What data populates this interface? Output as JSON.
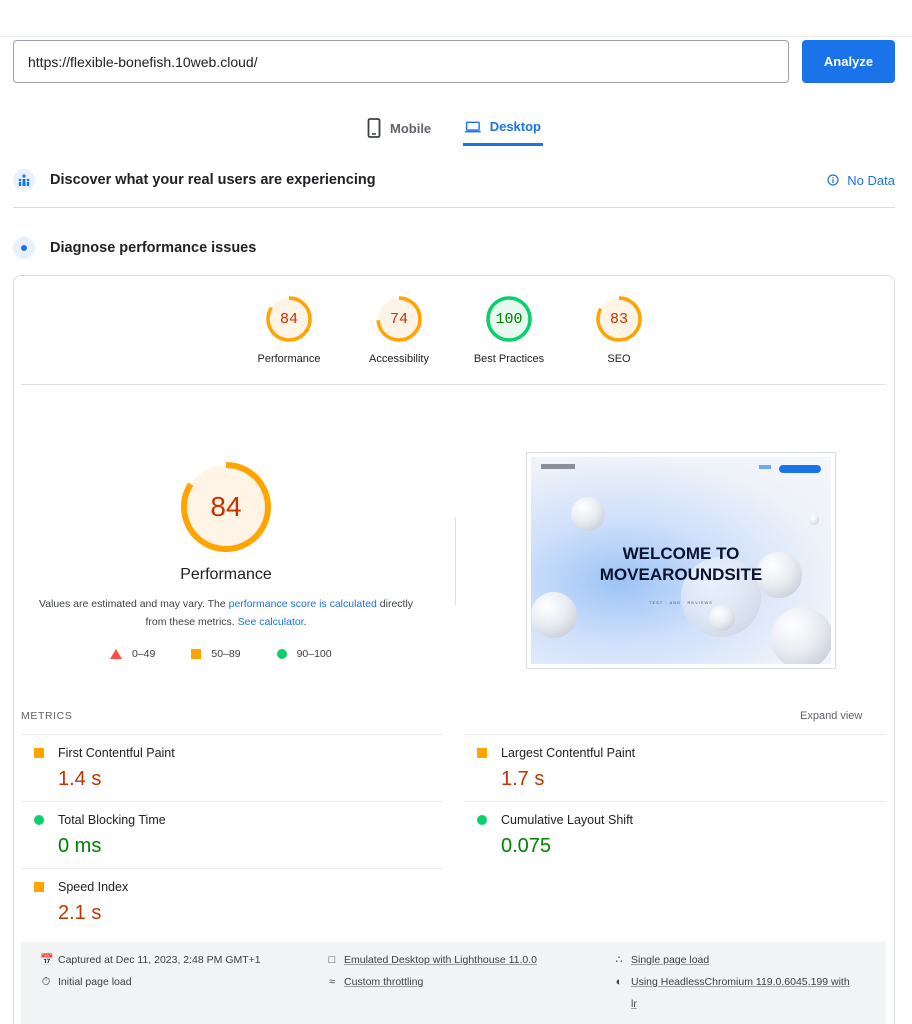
{
  "url_bar": {
    "value": "https://flexible-bonefish.10web.cloud/",
    "analyze_label": "Analyze"
  },
  "device_tabs": {
    "mobile": "Mobile",
    "desktop": "Desktop",
    "selected": "desktop"
  },
  "field_data": {
    "title": "Discover what your real users are experiencing",
    "status": "No Data"
  },
  "lab_data": {
    "title": "Diagnose performance issues"
  },
  "category_scores": [
    {
      "label": "Performance",
      "score": "84",
      "status": "average"
    },
    {
      "label": "Accessibility",
      "score": "74",
      "status": "average"
    },
    {
      "label": "Best Practices",
      "score": "100",
      "status": "pass"
    },
    {
      "label": "SEO",
      "score": "83",
      "status": "average"
    }
  ],
  "performance": {
    "score": "84",
    "title": "Performance",
    "desc_prefix": "Values are estimated and may vary. The ",
    "desc_link": "performance score is calculated",
    "desc_middle": " directly from these metrics. ",
    "desc_link2": "See calculator",
    "desc_suffix": "."
  },
  "legend": [
    {
      "shape": "triangle",
      "color": "#ff4e42",
      "label": "0–49"
    },
    {
      "shape": "square",
      "color": "#ffa400",
      "label": "50–89"
    },
    {
      "shape": "circle",
      "color": "#0cce6b",
      "label": "90–100"
    }
  ],
  "screenshot": {
    "heading_line1": "WELCOME TO",
    "heading_line2": "MOVEAROUNDSITE",
    "subheading": "TEST · AND · REVIEWS"
  },
  "metrics": {
    "label": "METRICS",
    "expand_label": "Expand view",
    "items": [
      {
        "name": "First Contentful Paint",
        "value": "1.4 s",
        "status": "average"
      },
      {
        "name": "Largest Contentful Paint",
        "value": "1.7 s",
        "status": "average"
      },
      {
        "name": "Total Blocking Time",
        "value": "0 ms",
        "status": "pass"
      },
      {
        "name": "Cumulative Layout Shift",
        "value": "0.075",
        "status": "pass"
      },
      {
        "name": "Speed Index",
        "value": "2.1 s",
        "status": "average"
      }
    ]
  },
  "footer": {
    "captured": "Captured at Dec 11, 2023, 2:48 PM GMT+1",
    "initial_load": "Initial page load",
    "emulated": "Emulated Desktop with Lighthouse 11.0.0",
    "throttling": "Custom throttling",
    "single_page": "Single page load",
    "browser_line1": "Using HeadlessChromium 119.0.6045.199 with",
    "browser_line2": "lr"
  },
  "colors": {
    "accent": "#1a73e8",
    "average": "#ffa400",
    "average_text": "#c33300",
    "pass": "#0cce6b",
    "pass_text": "#008000",
    "fail": "#ff4e42"
  }
}
